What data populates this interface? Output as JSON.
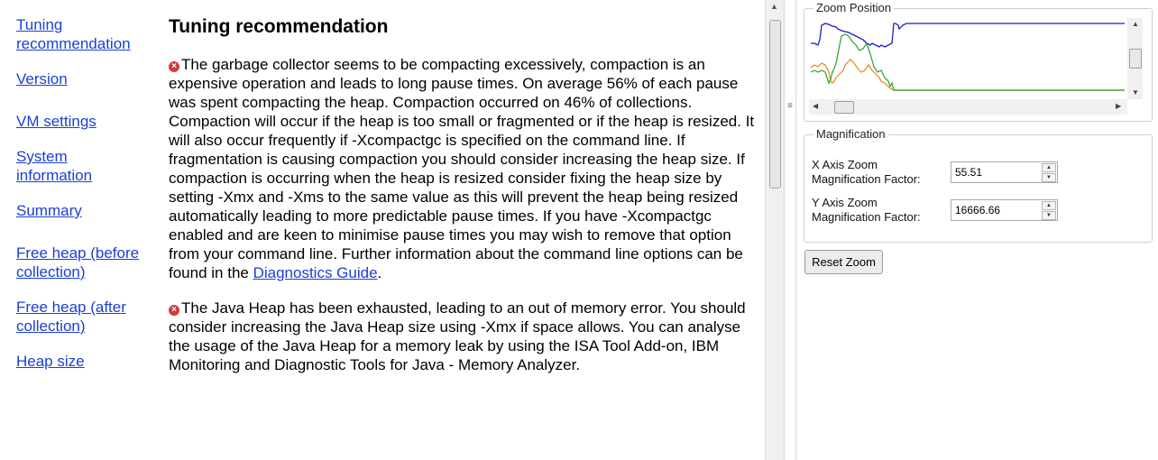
{
  "nav": {
    "items": [
      {
        "label": "Tuning recommendation"
      },
      {
        "label": "Version"
      },
      {
        "label": "VM settings"
      },
      {
        "label": "System information"
      },
      {
        "label": "Summary"
      },
      {
        "label": "Free heap (before collection)"
      },
      {
        "label": "Free heap (after collection)"
      },
      {
        "label": "Heap size"
      }
    ]
  },
  "content": {
    "title": "Tuning recommendation",
    "para1_text": "The garbage collector seems to be compacting excessively, compaction is an expensive operation and leads to long pause times. On average 56% of each pause was spent compacting the heap. Compaction occurred on 46% of collections. Compaction will occur if the heap is too small or fragmented or if the heap is resized. It will also occur frequently if -Xcompactgc is specified on the command line. If fragmentation is causing compaction you should consider increasing the heap size. If compaction is occurring when the heap is resized consider fixing the heap size by setting -Xmx and -Xms to the same value as this will prevent the heap being resized automatically leading to more predictable pause times. If you have -Xcompactgc enabled and are keen to minimise pause times you may wish to remove that option from your command line. Further information about the command line options can be found in the ",
    "para1_link": "Diagnostics Guide",
    "para1_end": ".",
    "para2_text": "The Java Heap has been exhausted, leading to an out of memory error. You should consider increasing the Java Heap size using -Xmx if space allows. You can analyse the usage of the Java Heap for a memory leak by using the ISA Tool Add-on, IBM Monitoring and Diagnostic Tools for Java - Memory Analyzer."
  },
  "zoom": {
    "title": "Zoom Position"
  },
  "magnification": {
    "title": "Magnification",
    "x_label": "X Axis Zoom Magnification Factor:",
    "x_value": "55.51",
    "y_label": "Y Axis Zoom Magnification Factor:",
    "y_value": "16666.66"
  },
  "reset_label": "Reset Zoom",
  "colors": {
    "link": "#1a3fd6",
    "error_icon": "#d23c3c",
    "line_blue": "#1c1ccf",
    "line_orange": "#e8861c",
    "line_green": "#2aa02a"
  }
}
